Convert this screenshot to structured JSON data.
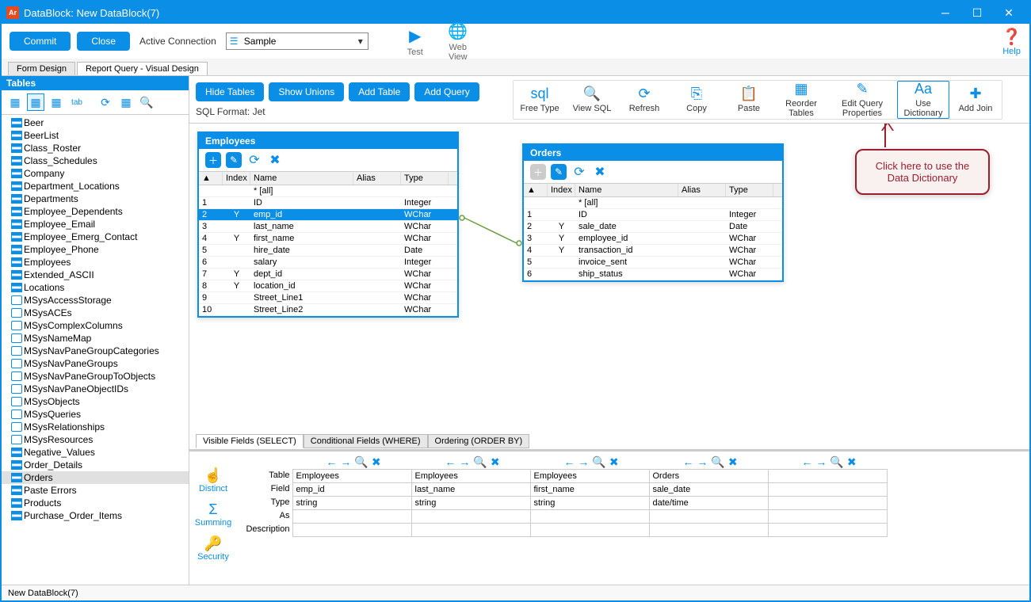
{
  "titlebar": {
    "app_badge": "Ar",
    "title": "DataBlock: New DataBlock(7)"
  },
  "top_toolbar": {
    "commit": "Commit",
    "close": "Close",
    "active_connection_label": "Active Connection",
    "connection_value": "Sample",
    "test": "Test",
    "web_view": "Web View",
    "help": "Help"
  },
  "main_tabs": {
    "form_design": "Form Design",
    "report_query": "Report Query - Visual Design"
  },
  "sidebar": {
    "title": "Tables",
    "items": [
      {
        "label": "Beer",
        "kind": "table"
      },
      {
        "label": "BeerList",
        "kind": "table"
      },
      {
        "label": "Class_Roster",
        "kind": "table"
      },
      {
        "label": "Class_Schedules",
        "kind": "table"
      },
      {
        "label": "Company",
        "kind": "table"
      },
      {
        "label": "Department_Locations",
        "kind": "table"
      },
      {
        "label": "Departments",
        "kind": "table"
      },
      {
        "label": "Employee_Dependents",
        "kind": "table"
      },
      {
        "label": "Employee_Email",
        "kind": "table"
      },
      {
        "label": "Employee_Emerg_Contact",
        "kind": "table"
      },
      {
        "label": "Employee_Phone",
        "kind": "table"
      },
      {
        "label": "Employees",
        "kind": "table"
      },
      {
        "label": "Extended_ASCII",
        "kind": "table"
      },
      {
        "label": "Locations",
        "kind": "table"
      },
      {
        "label": "MSysAccessStorage",
        "kind": "sys"
      },
      {
        "label": "MSysACEs",
        "kind": "sys"
      },
      {
        "label": "MSysComplexColumns",
        "kind": "sys"
      },
      {
        "label": "MSysNameMap",
        "kind": "sys"
      },
      {
        "label": "MSysNavPaneGroupCategories",
        "kind": "sys"
      },
      {
        "label": "MSysNavPaneGroups",
        "kind": "sys"
      },
      {
        "label": "MSysNavPaneGroupToObjects",
        "kind": "sys"
      },
      {
        "label": "MSysNavPaneObjectIDs",
        "kind": "sys"
      },
      {
        "label": "MSysObjects",
        "kind": "sys"
      },
      {
        "label": "MSysQueries",
        "kind": "sys"
      },
      {
        "label": "MSysRelationships",
        "kind": "sys"
      },
      {
        "label": "MSysResources",
        "kind": "sys"
      },
      {
        "label": "Negative_Values",
        "kind": "table"
      },
      {
        "label": "Order_Details",
        "kind": "table"
      },
      {
        "label": "Orders",
        "kind": "table",
        "selected": true
      },
      {
        "label": "Paste Errors",
        "kind": "table"
      },
      {
        "label": "Products",
        "kind": "table"
      },
      {
        "label": "Purchase_Order_Items",
        "kind": "table"
      }
    ]
  },
  "canvas_toolbar": {
    "hide_tables": "Hide Tables",
    "show_unions": "Show Unions",
    "add_table": "Add Table",
    "add_query": "Add Query",
    "sql_format": "SQL Format: Jet",
    "actions": [
      {
        "key": "free-type",
        "label": "Free Type"
      },
      {
        "key": "view-sql",
        "label": "View SQL"
      },
      {
        "key": "refresh",
        "label": "Refresh"
      },
      {
        "key": "copy",
        "label": "Copy"
      },
      {
        "key": "paste",
        "label": "Paste",
        "disabled": true
      },
      {
        "key": "reorder-tables",
        "label": "Reorder Tables"
      },
      {
        "key": "edit-query-properties",
        "label": "Edit Query Properties",
        "wide": true
      },
      {
        "key": "use-dictionary",
        "label": "Use Dictionary",
        "highlight": true
      },
      {
        "key": "add-join",
        "label": "Add Join"
      }
    ]
  },
  "employees_card": {
    "title": "Employees",
    "headers": {
      "num": "",
      "index": "Index",
      "name": "Name",
      "alias": "Alias",
      "type": "Type"
    },
    "all_row": "* [all]",
    "rows": [
      {
        "n": "1",
        "idx": "",
        "name": "ID",
        "alias": "",
        "type": "Integer"
      },
      {
        "n": "2",
        "idx": "Y",
        "name": "emp_id",
        "alias": "",
        "type": "WChar",
        "selected": true
      },
      {
        "n": "3",
        "idx": "",
        "name": "last_name",
        "alias": "",
        "type": "WChar"
      },
      {
        "n": "4",
        "idx": "Y",
        "name": "first_name",
        "alias": "",
        "type": "WChar"
      },
      {
        "n": "5",
        "idx": "",
        "name": "hire_date",
        "alias": "",
        "type": "Date"
      },
      {
        "n": "6",
        "idx": "",
        "name": "salary",
        "alias": "",
        "type": "Integer"
      },
      {
        "n": "7",
        "idx": "Y",
        "name": "dept_id",
        "alias": "",
        "type": "WChar"
      },
      {
        "n": "8",
        "idx": "Y",
        "name": "location_id",
        "alias": "",
        "type": "WChar"
      },
      {
        "n": "9",
        "idx": "",
        "name": "Street_Line1",
        "alias": "",
        "type": "WChar"
      },
      {
        "n": "10",
        "idx": "",
        "name": "Street_Line2",
        "alias": "",
        "type": "WChar"
      }
    ]
  },
  "orders_card": {
    "title": "Orders",
    "headers": {
      "num": "",
      "index": "Index",
      "name": "Name",
      "alias": "Alias",
      "type": "Type"
    },
    "all_row": "* [all]",
    "rows": [
      {
        "n": "1",
        "idx": "",
        "name": "ID",
        "alias": "",
        "type": "Integer"
      },
      {
        "n": "2",
        "idx": "Y",
        "name": "sale_date",
        "alias": "",
        "type": "Date"
      },
      {
        "n": "3",
        "idx": "Y",
        "name": "employee_id",
        "alias": "",
        "type": "WChar"
      },
      {
        "n": "4",
        "idx": "Y",
        "name": "transaction_id",
        "alias": "",
        "type": "WChar"
      },
      {
        "n": "5",
        "idx": "",
        "name": "invoice_sent",
        "alias": "",
        "type": "WChar"
      },
      {
        "n": "6",
        "idx": "",
        "name": "ship_status",
        "alias": "",
        "type": "WChar"
      }
    ]
  },
  "callout": {
    "line1": "Click here to use the",
    "line2": "Data Dictionary"
  },
  "bottom_tabs": {
    "visible_fields": "Visible Fields (SELECT)",
    "conditional_fields": "Conditional Fields (WHERE)",
    "ordering": "Ordering (ORDER BY)"
  },
  "bottom_left": {
    "distinct": "Distinct",
    "summing": "Summing",
    "security": "Security"
  },
  "field_grid": {
    "labels": {
      "table": "Table",
      "field": "Field",
      "type": "Type",
      "as": "As",
      "description": "Description"
    },
    "columns": [
      {
        "table": "Employees",
        "field": "emp_id",
        "type": "string",
        "as": "",
        "description": ""
      },
      {
        "table": "Employees",
        "field": "last_name",
        "type": "string",
        "as": "",
        "description": ""
      },
      {
        "table": "Employees",
        "field": "first_name",
        "type": "string",
        "as": "",
        "description": ""
      },
      {
        "table": "Orders",
        "field": "sale_date",
        "type": "date/time",
        "as": "",
        "description": ""
      },
      {
        "table": "",
        "field": "",
        "type": "",
        "as": "",
        "description": ""
      }
    ]
  },
  "statusbar": {
    "text": "New DataBlock(7)"
  }
}
